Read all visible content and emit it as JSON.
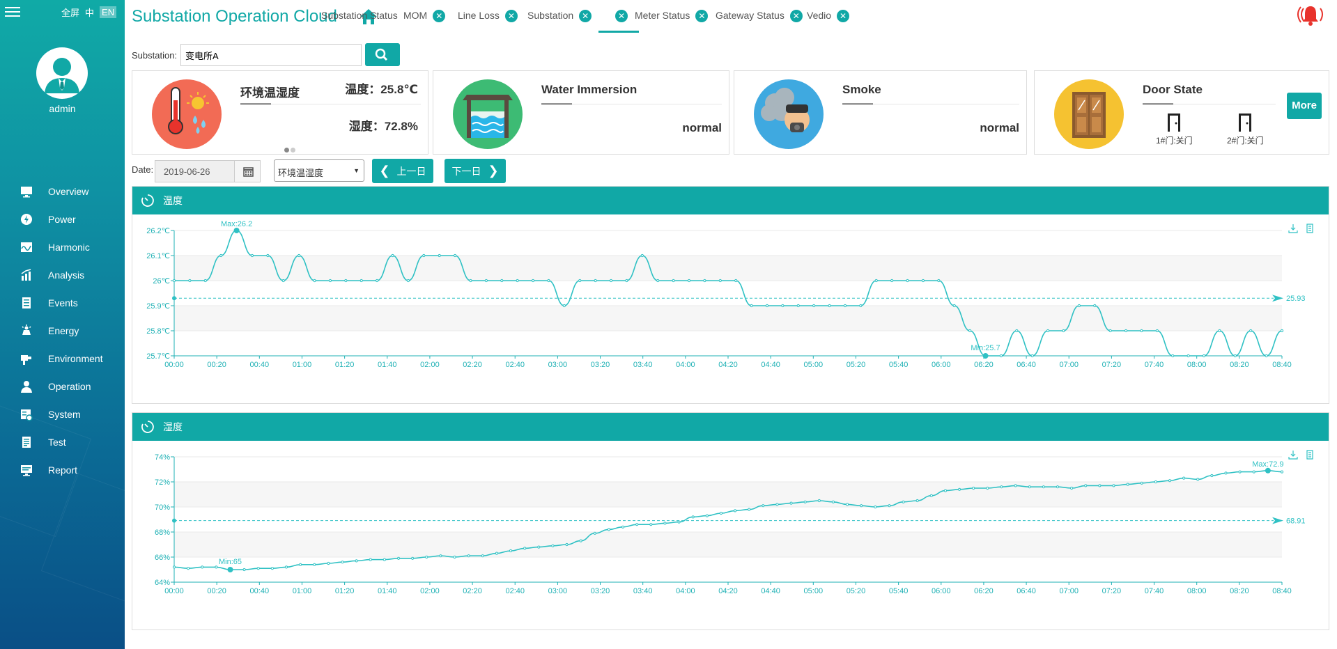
{
  "sidebar": {
    "lang_fullscreen": "全屏",
    "lang_zh": "中",
    "lang_en": "EN",
    "username": "admin",
    "items": [
      {
        "label": "Overview",
        "icon": "monitor-icon"
      },
      {
        "label": "Power",
        "icon": "power-icon"
      },
      {
        "label": "Harmonic",
        "icon": "harmonic-icon"
      },
      {
        "label": "Analysis",
        "icon": "analysis-icon"
      },
      {
        "label": "Events",
        "icon": "events-icon"
      },
      {
        "label": "Energy",
        "icon": "energy-icon"
      },
      {
        "label": "Environment",
        "icon": "environment-icon"
      },
      {
        "label": "Operation",
        "icon": "operation-icon"
      },
      {
        "label": "System",
        "icon": "system-icon"
      },
      {
        "label": "Test",
        "icon": "test-icon"
      },
      {
        "label": "Report",
        "icon": "report-icon"
      }
    ]
  },
  "header": {
    "title": "Substation Operation Cloud",
    "tabs": [
      {
        "label": "Substation Status",
        "closable": false
      },
      {
        "label": "MOM",
        "closable": true
      },
      {
        "label": "Line Loss",
        "closable": true
      },
      {
        "label": "Substation",
        "closable": true
      },
      {
        "label": "",
        "closable": true,
        "active": true
      },
      {
        "label": "Meter Status",
        "closable": true
      },
      {
        "label": "Gateway Status",
        "closable": true
      },
      {
        "label": "Vedio",
        "closable": true
      }
    ]
  },
  "substation": {
    "label": "Substation:",
    "value": "变电所A"
  },
  "cards": {
    "env": {
      "title": "环境温湿度",
      "temp": "温度：25.8℃",
      "hum": "湿度：72.8%"
    },
    "water": {
      "title": "Water Immersion",
      "status": "normal"
    },
    "smoke": {
      "title": "Smoke",
      "status": "normal"
    },
    "door": {
      "title": "Door State",
      "more": "More",
      "doors": [
        "1#门:关门",
        "2#门:关门"
      ]
    }
  },
  "datebar": {
    "label": "Date:",
    "date": "2019-06-26",
    "select": "环境温湿度",
    "prev": "上一日",
    "next": "下一日"
  },
  "chart_data": [
    {
      "type": "line",
      "title": "温度",
      "unit": "℃",
      "x": [
        "00:00",
        "00:10",
        "00:20",
        "00:30",
        "00:40",
        "00:50",
        "01:00",
        "01:10",
        "01:20",
        "01:30",
        "01:40",
        "01:50",
        "02:00",
        "02:10",
        "02:20",
        "02:30",
        "02:40",
        "02:50",
        "03:00",
        "03:10",
        "03:20",
        "03:30",
        "03:40",
        "03:50",
        "04:00",
        "04:10",
        "04:20",
        "04:30",
        "04:40",
        "04:50",
        "05:00",
        "05:10",
        "05:20",
        "05:30",
        "05:40",
        "05:50",
        "06:00",
        "06:10",
        "06:20",
        "06:30",
        "06:40",
        "06:50",
        "07:00",
        "07:10",
        "07:20",
        "07:30",
        "07:40",
        "07:50",
        "08:00",
        "08:10",
        "08:20",
        "08:30",
        "08:40"
      ],
      "values": [
        26.0,
        26.0,
        26.0,
        26.1,
        26.2,
        26.1,
        26.1,
        26.0,
        26.1,
        26.0,
        26.0,
        26.0,
        26.0,
        26.0,
        26.1,
        26.0,
        26.1,
        26.1,
        26.1,
        26.0,
        26.0,
        26.0,
        26.0,
        26.0,
        26.0,
        25.9,
        26.0,
        26.0,
        26.0,
        26.0,
        26.1,
        26.0,
        26.0,
        26.0,
        26.0,
        26.0,
        26.0,
        25.9,
        25.9,
        25.9,
        25.9,
        25.9,
        25.9,
        25.9,
        25.9,
        26.0,
        26.0,
        26.0,
        26.0,
        26.0,
        25.9,
        25.8,
        25.7,
        25.7,
        25.8,
        25.7,
        25.8,
        25.8,
        25.9,
        25.9,
        25.8,
        25.8,
        25.8,
        25.8,
        25.7,
        25.7,
        25.7,
        25.8,
        25.7,
        25.8,
        25.7,
        25.8
      ],
      "x_ticks": [
        "00:00",
        "00:20",
        "00:40",
        "01:00",
        "01:20",
        "01:40",
        "02:00",
        "02:20",
        "02:40",
        "03:00",
        "03:20",
        "03:40",
        "04:00",
        "04:20",
        "04:40",
        "05:00",
        "05:20",
        "05:40",
        "06:00",
        "06:20",
        "06:40",
        "07:00",
        "07:20",
        "07:40",
        "08:00",
        "08:20",
        "08:40"
      ],
      "y_ticks": [
        "25.7℃",
        "25.8℃",
        "25.9℃",
        "26℃",
        "26.1℃",
        "26.2℃"
      ],
      "ylim": [
        25.7,
        26.2
      ],
      "max_label": "Max:26.2",
      "min_label": "Min:25.7",
      "avg": 25.93,
      "avg_label": "25.93"
    },
    {
      "type": "line",
      "title": "湿度",
      "unit": "%",
      "values": [
        65.2,
        65.1,
        65.2,
        65.2,
        65.0,
        65.0,
        65.1,
        65.1,
        65.2,
        65.4,
        65.4,
        65.5,
        65.6,
        65.7,
        65.8,
        65.8,
        65.9,
        65.9,
        66.0,
        66.1,
        66.0,
        66.1,
        66.1,
        66.3,
        66.5,
        66.7,
        66.8,
        66.9,
        67.0,
        67.3,
        67.9,
        68.2,
        68.4,
        68.6,
        68.6,
        68.7,
        68.8,
        69.2,
        69.3,
        69.5,
        69.7,
        69.8,
        70.1,
        70.2,
        70.3,
        70.4,
        70.5,
        70.4,
        70.2,
        70.1,
        70.0,
        70.1,
        70.4,
        70.5,
        70.9,
        71.3,
        71.4,
        71.5,
        71.5,
        71.6,
        71.7,
        71.6,
        71.6,
        71.6,
        71.5,
        71.7,
        71.7,
        71.7,
        71.8,
        71.9,
        72.0,
        72.1,
        72.3,
        72.2,
        72.5,
        72.7,
        72.8,
        72.8,
        72.9,
        72.8
      ],
      "x_ticks": [
        "00:00",
        "00:20",
        "00:40",
        "01:00",
        "01:20",
        "01:40",
        "02:00",
        "02:20",
        "02:40",
        "03:00",
        "03:20",
        "03:40",
        "04:00",
        "04:20",
        "04:40",
        "05:00",
        "05:20",
        "05:40",
        "06:00",
        "06:20",
        "06:40",
        "07:00",
        "07:20",
        "07:40",
        "08:00",
        "08:20",
        "08:40"
      ],
      "y_ticks": [
        "64%",
        "66%",
        "68%",
        "70%",
        "72%",
        "74%"
      ],
      "ylim": [
        64,
        74
      ],
      "max_label": "Max:72.9",
      "min_label": "Min:65",
      "avg": 68.91,
      "avg_label": "68.91"
    }
  ],
  "colors": {
    "accent": "#11a8a6",
    "line": "#2fc1c4",
    "alarm": "#e8332c"
  }
}
